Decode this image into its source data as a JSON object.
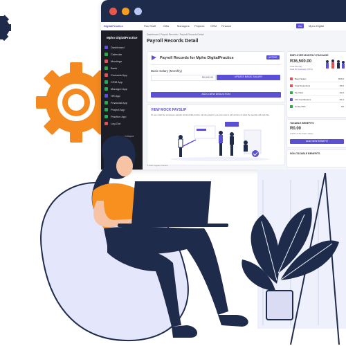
{
  "app": {
    "logo_text": "DigitalPractice",
    "nav_items": [
      "Find Staff",
      "Gifts",
      "Managers",
      "Projects",
      "CRM",
      "Finance"
    ],
    "search_label": "Go",
    "account_label": "Mpho Digital"
  },
  "sidebar": {
    "user_name": "Mpho DigitalPractice",
    "items": [
      "Dashboard",
      "Calendar",
      "Meetings",
      "Bank",
      "Contacts App",
      "CRM App",
      "Manager App",
      "HR App",
      "Financial App",
      "Project App",
      "Practice App",
      "Log Out"
    ],
    "footer_button": "Collapse"
  },
  "breadcrumb": [
    "Dashboard",
    "Payroll Records",
    "Payroll Records Detail"
  ],
  "page_title": "Payroll Records Detail",
  "payroll_card": {
    "title": "Payroll Records for Mpho DigitalPractice",
    "status": "ACTIVE",
    "basic_salary_label": "Basic Salary (Monthly)",
    "basic_salary_value": "R0,000.00",
    "update_button": "UPDATE BASIC SALARY",
    "add_deduction_button": "ADD A NEW DEDUCTION"
  },
  "payslip_card": {
    "title": "VIEW MOCK PAYSLIP",
    "description": "To see what the employee payslip will look like before running payroll, you can view a pdf version of what the payslip will look like."
  },
  "package_card": {
    "title": "EMPLOYEE MONTHLY PACKAGE",
    "amount": "R36,500.00",
    "subtitle1": "Total Monthly",
    "subtitle2": "Cost To Company (CTC)",
    "rows": [
      {
        "label": "Basic Salary",
        "value": "R35,0"
      },
      {
        "label": "Total Deductions",
        "value": "R5,0"
      },
      {
        "label": "Tax Paid",
        "value": "R2,0"
      },
      {
        "label": "UIF Contributions",
        "value": "R1,0"
      },
      {
        "label": "Hourly Rate",
        "value": "R2"
      }
    ]
  },
  "taxable_card": {
    "title": "TAXABLE BENEFITS",
    "amount": "R0.00",
    "subtitle": "0.00% of the basic salary",
    "button": "ADD NEW BENEFIT"
  },
  "non_taxable_title": "NON-TAXABLE BENEFITS",
  "footer": "© 2021 Digital Practice",
  "colors": {
    "accent": "#5b4fd6",
    "gear_orange": "#f4891f",
    "navy": "#1f2b4a",
    "chair": "#e4e6fb",
    "shirt": "#f7901e"
  }
}
